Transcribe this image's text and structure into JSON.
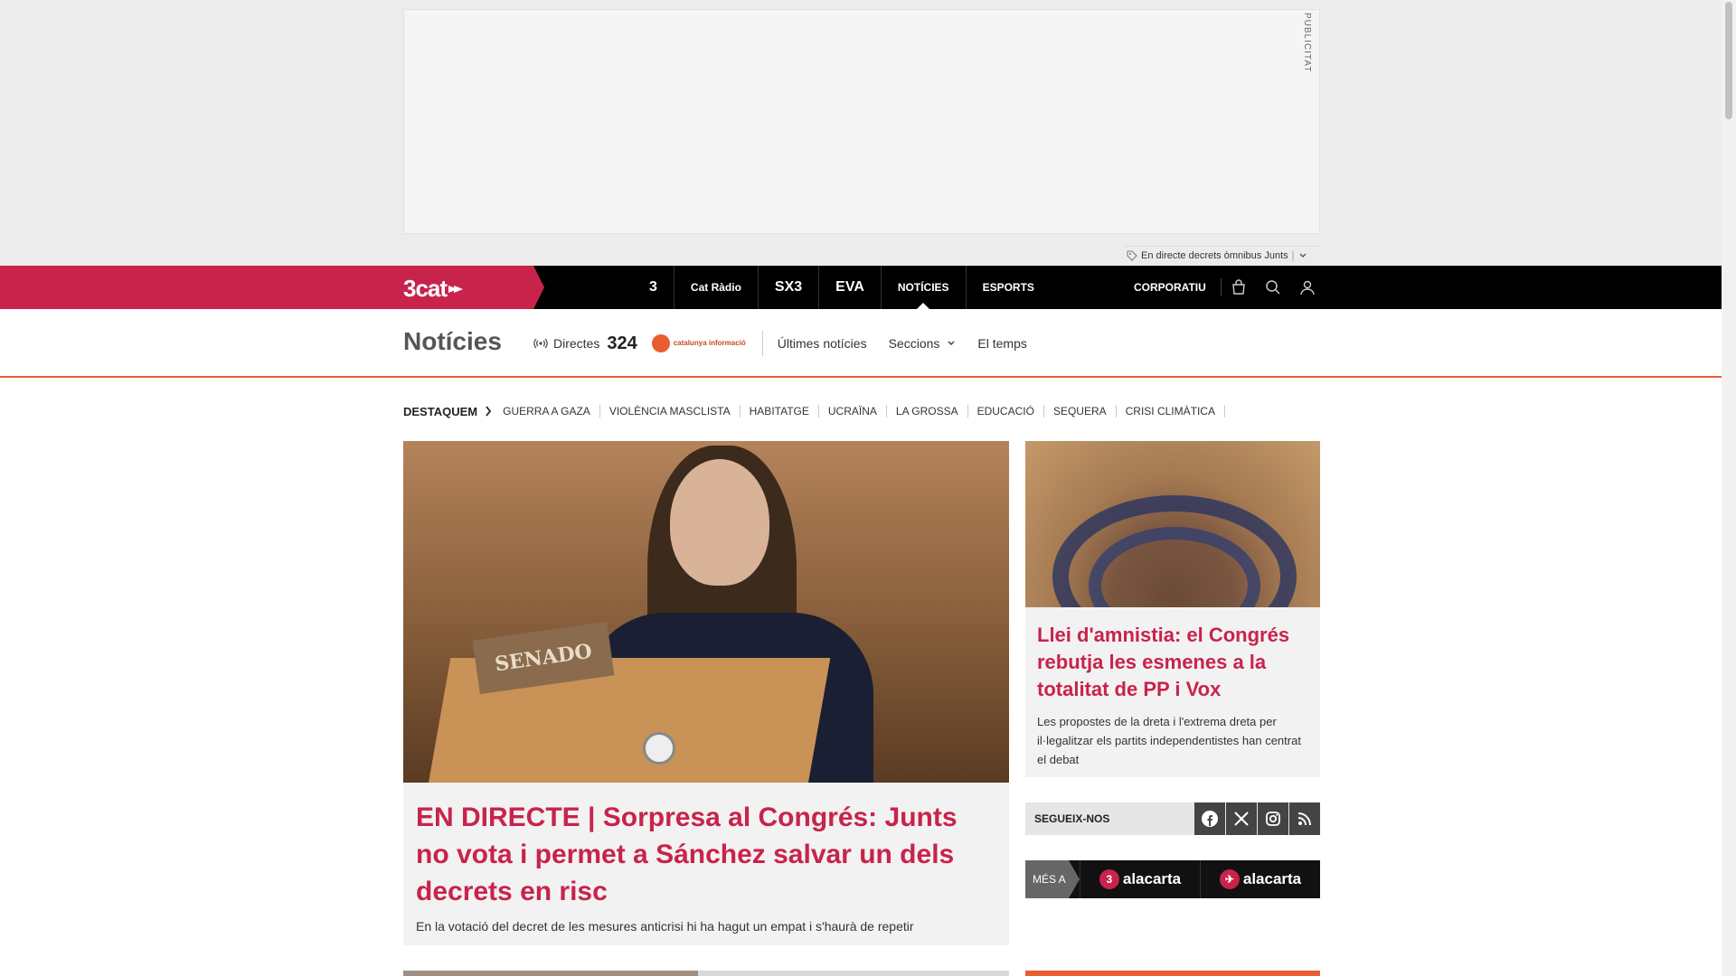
{
  "ad": {
    "label": "PUBLICITAT"
  },
  "live_ticker": {
    "text": "En directe decrets òmnibus Junts",
    "separator": "|"
  },
  "topnav": {
    "brand": "3cat",
    "channels": [
      {
        "label": "3",
        "icon": "tv3-logo"
      },
      {
        "label": "Cat Ràdio",
        "icon": "catradio-logo"
      },
      {
        "label": "SX3",
        "icon": "sx3-logo"
      },
      {
        "label": "EVA",
        "icon": "eva-logo"
      },
      {
        "label": "NOTÍCIES",
        "icon": ""
      },
      {
        "label": "ESPORTS",
        "icon": ""
      }
    ],
    "active_channel": "NOTÍCIES",
    "corporate": "CORPORATIU",
    "colors": {
      "brand": "#c8234b",
      "background": "#000000"
    }
  },
  "section": {
    "title": "Notícies",
    "directes": "Directes",
    "channel_324": "324",
    "catinfo": "catalunya informació",
    "links": [
      "Últimes notícies",
      "Seccions",
      "El temps"
    ],
    "accent": "#e85d32"
  },
  "destaquem": {
    "label": "DESTAQUEM",
    "items": [
      "GUERRA A GAZA",
      "VIOLÈNCIA MASCLISTA",
      "HABITATGE",
      "UCRAÏNA",
      "LA GROSSA",
      "EDUCACIÓ",
      "SEQUERA",
      "CRISI CLIMÀTICA"
    ]
  },
  "main_article": {
    "image_text": "SENADO",
    "headline": "EN DIRECTE | Sorpresa al Congrés: Junts no vota i permet a Sánchez salvar un dels decrets en risc",
    "subtitle": "En la votació del decret de les mesures anticrisi hi ha hagut un empat i s'haurà de repetir"
  },
  "side_article": {
    "headline": "Llei d'amnistia: el Congrés rebutja les esmenes a la totalitat de PP i Vox",
    "subtitle": "Les propostes de la dreta i l'extrema dreta per il·legalitzar els partits independentistes han centrat el debat"
  },
  "follow": {
    "label": "SEGUEIX-NOS",
    "networks": [
      "facebook",
      "x",
      "instagram",
      "rss"
    ]
  },
  "mes_a": {
    "label": "MÉS A",
    "items": [
      {
        "badge": "3",
        "label": "alacarta"
      },
      {
        "badge": "✈",
        "label": "alacarta"
      }
    ]
  }
}
